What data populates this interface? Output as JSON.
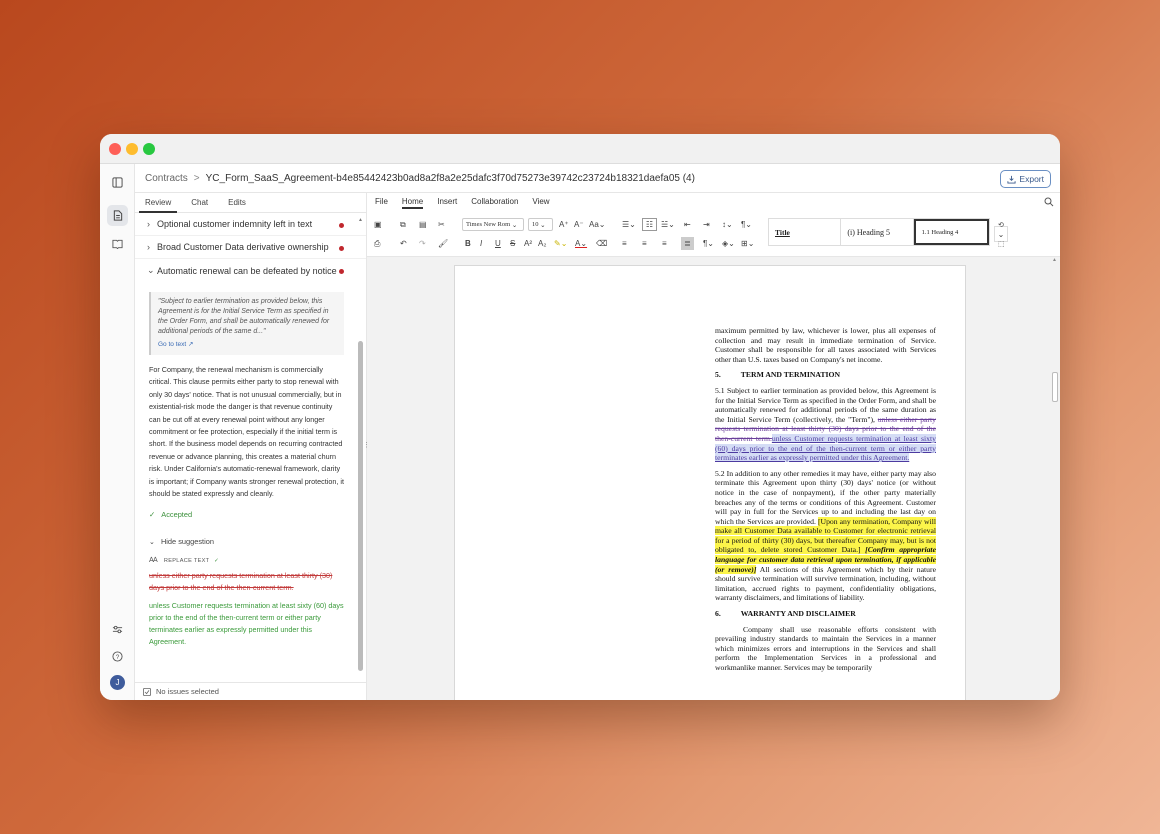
{
  "header": {
    "breadcrumb_root": "Contracts",
    "breadcrumb_sep": ">",
    "doc_title": "YC_Form_SaaS_Agreement-b4e85442423b0ad8a2f8a2e25dafc3f70d75273e39742c23724b18321daefa05 (4)",
    "export_label": "Export"
  },
  "rail": {
    "avatar_initial": "J"
  },
  "left_tabs": [
    "Review",
    "Chat",
    "Edits"
  ],
  "issues": [
    {
      "label": "Optional customer indemnity left in text"
    },
    {
      "label": "Broad Customer Data derivative ownership"
    },
    {
      "label": "Automatic renewal can be defeated by notice"
    }
  ],
  "detail": {
    "quote": "\"Subject to earlier termination as provided below, this Agreement is for the Initial Service Term as specified in the Order Form, and shall be automatically renewed for additional periods of the same d...\"",
    "go_to_text": "Go to text ↗",
    "explanation": "For Company, the renewal mechanism is commercially critical. This clause permits either party to stop renewal with only 30 days' notice. That is not unusual commercially, but in existential-risk mode the danger is that revenue continuity can be cut off at every renewal point without any longer commitment or fee protection, especially if the initial term is short. If the business model depends on recurring contracted revenue or advance planning, this creates a material churn risk. Under California's automatic-renewal framework, clarity is important; if Company wants stronger renewal protection, it should be stated expressly and cleanly.",
    "accepted": "Accepted",
    "hide_suggestion": "Hide suggestion",
    "replace_text": "REPLACE TEXT",
    "deleted_text": "unless either party requests termination at least thirty (30) days prior to the end of the then-current term.",
    "inserted_text": "unless Customer requests termination at least sixty (60) days prior to the end of the then-current term or either party terminates earlier as expressly permitted under this Agreement."
  },
  "footer": {
    "status": "No issues selected"
  },
  "menu": [
    "File",
    "Home",
    "Insert",
    "Collaboration",
    "View"
  ],
  "toolbar": {
    "font_family": "Times New Rom",
    "font_size": "10",
    "style_1": "Title",
    "style_2": "(i) Heading 5",
    "style_3": "1.1 Heading 4"
  },
  "document": {
    "p0": "maximum permitted by law, whichever is lower, plus all expenses of collection and may result in immediate termination of Service. Customer shall be responsible for all taxes associated with Services other than U.S. taxes based on Company's net income.",
    "h5_num": "5.",
    "h5_title": "TERM AND TERMINATION",
    "p51_a": "5.1        Subject to earlier termination as provided below, this Agreement is for the Initial Service Term as specified in the Order Form, and shall be automatically renewed for additional periods of the same duration as the Initial Service Term (collectively, the \"Term\"), ",
    "p51_del": "unless either party requests termination at least thirty (30) days prior to the end of the then-current term.",
    "p51_ins": "unless Customer requests termination at least sixty (60) days prior to the end of the then-current term or either party terminates earlier as expressly permitted under this Agreement.",
    "p52_a": "5.2        In addition to any other remedies it may have, either party may also terminate this Agreement upon thirty (30) days' notice (or without notice in the case of nonpayment), if the other party materially breaches any of the terms or conditions of this Agreement.  Customer will pay in full for the Services up to and including the last day on which the Services are provided. ",
    "p52_hl": "[Upon any termination, Company will make all Customer Data available to Customer for electronic retrieval for a period of thirty (30) days, but thereafter Company may, but is not obligated to, delete stored Customer Data.]",
    "p52_note": " [Confirm appropriate language for customer  data retrieval upon termination, if applicable (or remove)]",
    "p52_b": "  All sections of this Agreement which by their nature should survive termination will survive termination, including, without limitation, accrued rights to payment, confidentiality obligations, warranty disclaimers, and limitations of liability.",
    "h6_num": "6.",
    "h6_title": "WARRANTY AND DISCLAIMER",
    "p6": "Company shall use reasonable efforts consistent with prevailing industry standards to maintain the Services in a manner which minimizes errors and interruptions in the Services and shall perform the Implementation Services in a professional and workmanlike manner. Services may be temporarily"
  }
}
